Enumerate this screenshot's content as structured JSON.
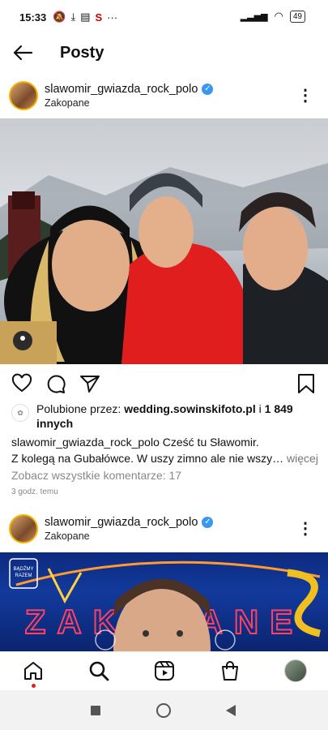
{
  "status": {
    "time": "15:33",
    "battery": "49"
  },
  "header": {
    "title": "Posty"
  },
  "posts": [
    {
      "username": "slawomir_gwiazda_rock_polo",
      "location": "Zakopane",
      "likes_prefix": "Polubione przez:",
      "likes_user": "wedding.sowinskifoto.pl",
      "likes_suffix": "i",
      "likes_count": "1 849",
      "likes_tail": "innych",
      "caption_user": "slawomir_gwiazda_rock_polo",
      "caption_line1": "Cześć tu Sławomir.",
      "caption_line2": "Z kolegą na Gubałówce. W uszy zimno ale nie wszy…",
      "caption_more": "więcej",
      "comments_link": "Zobacz wszystkie komentarze: 17",
      "time_ago": "3 godz. temu"
    },
    {
      "username": "slawomir_gwiazda_rock_polo",
      "location": "Zakopane",
      "poster_text": "ZAKOPANE",
      "badge_line1": "BĄDŹMY",
      "badge_line2": "RAZEM"
    }
  ],
  "colors": {
    "verified": "#3897f0",
    "accent_red": "#e02020"
  }
}
